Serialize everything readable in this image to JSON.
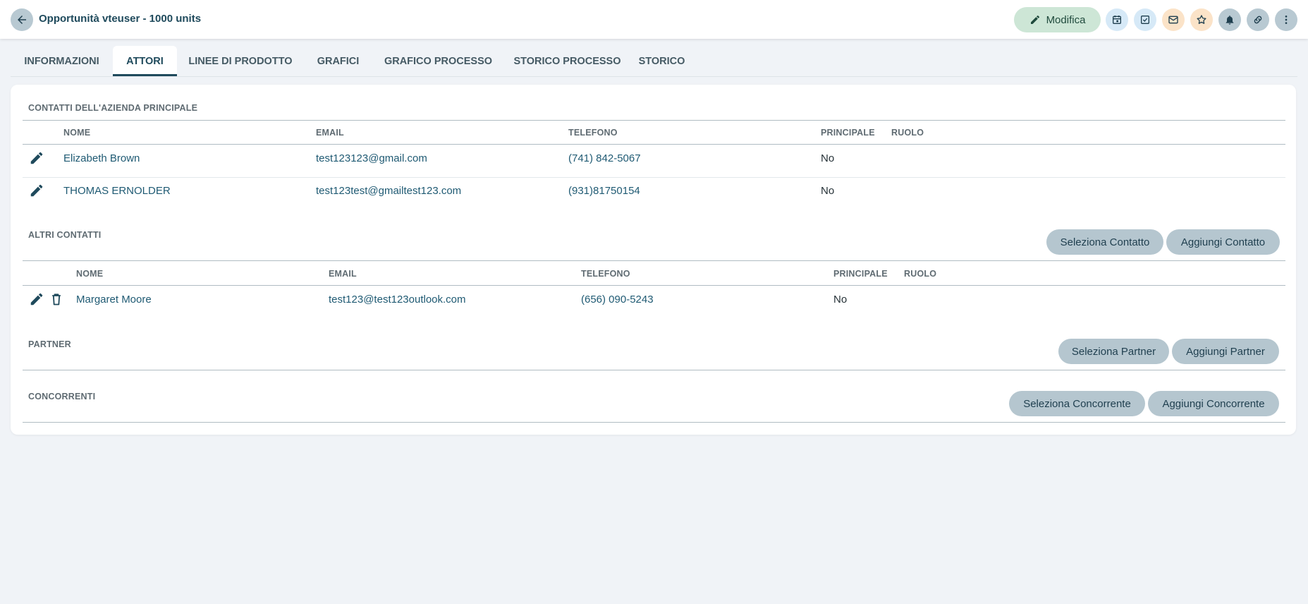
{
  "header": {
    "title": "Opportunità vteuser - 1000 units",
    "edit_label": "Modifica",
    "icons": [
      {
        "name": "calendar-icon",
        "bg": "#d6e9f7"
      },
      {
        "name": "task-check-icon",
        "bg": "#d6e9f7"
      },
      {
        "name": "mail-icon",
        "bg": "#fbe3c8"
      },
      {
        "name": "star-icon",
        "bg": "#fbe3c8"
      },
      {
        "name": "bell-icon",
        "bg": "#b8c9d2"
      },
      {
        "name": "link-icon",
        "bg": "#b8c9d2"
      },
      {
        "name": "more-vert-icon",
        "bg": "#b8c9d2"
      }
    ]
  },
  "tabs": [
    {
      "label": "INFORMAZIONI",
      "active": false
    },
    {
      "label": "ATTORI",
      "active": true
    },
    {
      "label": "LINEE DI PRODOTTO",
      "active": false
    },
    {
      "label": "GRAFICI",
      "active": false
    },
    {
      "label": "GRAFICO PROCESSO",
      "active": false
    },
    {
      "label": "STORICO PROCESSO",
      "active": false
    },
    {
      "label": "STORICO",
      "active": false
    }
  ],
  "main_contacts": {
    "title": "CONTATTI DELL'AZIENDA PRINCIPALE",
    "columns": {
      "name": "NOME",
      "email": "EMAIL",
      "phone": "TELEFONO",
      "primary": "PRINCIPALE",
      "role": "RUOLO"
    },
    "rows": [
      {
        "name": "Elizabeth Brown",
        "email": "test123123@gmail.com",
        "phone": "(741) 842-5067",
        "primary": "No",
        "role": ""
      },
      {
        "name": "THOMAS ERNOLDER",
        "email": "test123test@gmailtest123.com",
        "phone": "(931)81750154",
        "primary": "No",
        "role": ""
      }
    ]
  },
  "other_contacts": {
    "title": "ALTRI CONTATTI",
    "select_label": "Seleziona Contatto",
    "add_label": "Aggiungi Contatto",
    "columns": {
      "name": "NOME",
      "email": "EMAIL",
      "phone": "TELEFONO",
      "primary": "PRINCIPALE",
      "role": "RUOLO"
    },
    "rows": [
      {
        "name": "Margaret Moore",
        "email": "test123@test123outlook.com",
        "phone": "(656) 090-5243",
        "primary": "No",
        "role": ""
      }
    ]
  },
  "partner": {
    "title": "PARTNER",
    "select_label": "Seleziona Partner",
    "add_label": "Aggiungi Partner"
  },
  "competitors": {
    "title": "CONCORRENTI",
    "select_label": "Seleziona Concorrente",
    "add_label": "Aggiungi Concorrente"
  }
}
